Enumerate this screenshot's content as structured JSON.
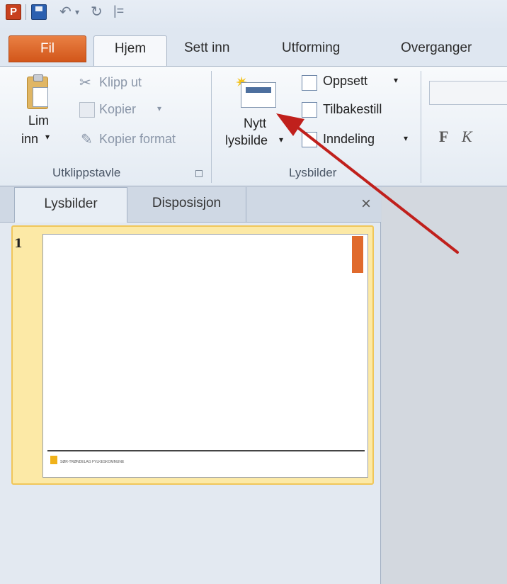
{
  "quick_access": {
    "app_icon": "P",
    "save_icon": "save-icon",
    "undo_glyph": "↶",
    "redo_glyph": "↻",
    "customize_glyph": "|="
  },
  "tabs": {
    "file": "Fil",
    "home": "Hjem",
    "insert": "Sett inn",
    "design": "Utforming",
    "transitions": "Overganger"
  },
  "clipboard": {
    "paste_line1": "Lim",
    "paste_line2": "inn",
    "cut": "Klipp ut",
    "copy": "Kopier",
    "format_painter": "Kopier format",
    "group_label": "Utklippstavle"
  },
  "slides": {
    "new_slide_line1": "Nytt",
    "new_slide_line2": "lysbilde",
    "layout": "Oppsett",
    "reset": "Tilbakestill",
    "section": "Inndeling",
    "group_label": "Lysbilder"
  },
  "font": {
    "bold": "F",
    "italic": "K"
  },
  "pane": {
    "tab_slides": "Lysbilder",
    "tab_outline": "Disposisjon",
    "close": "×"
  },
  "thumbnail": {
    "number": "1",
    "footer_text": "SØR-TRØNDELAG FYLKESKOMMUNE"
  },
  "colors": {
    "file_tab": "#d2561a",
    "arrow": "#c0201c",
    "selection": "#f0c65a"
  }
}
